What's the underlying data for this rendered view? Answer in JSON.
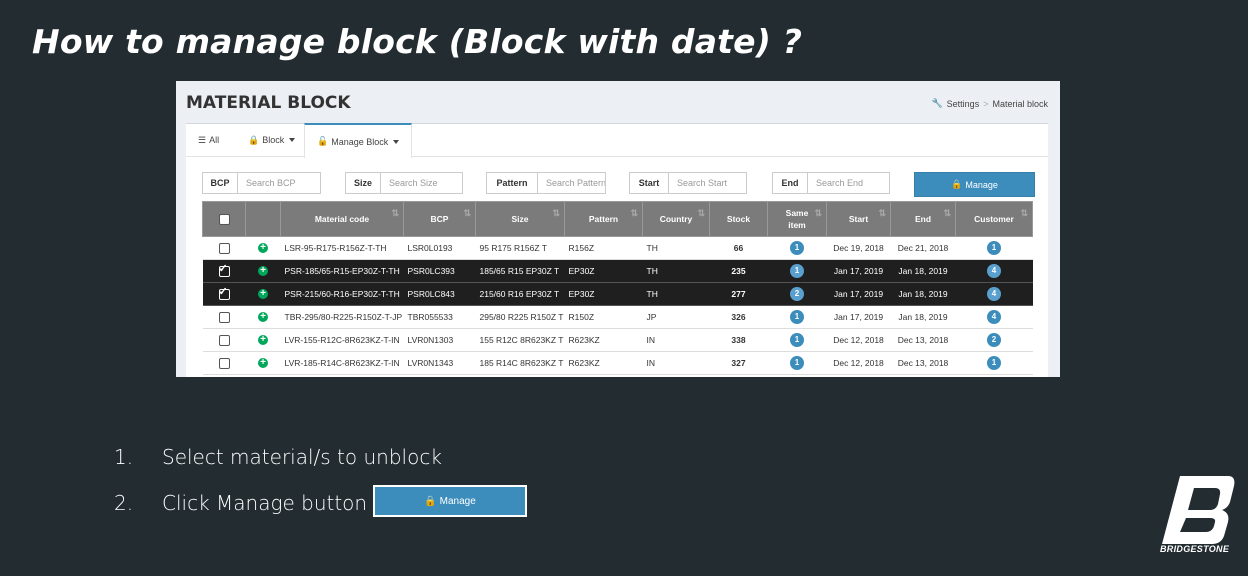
{
  "slide": {
    "title": "How to manage block (Block with date) ?"
  },
  "header": {
    "title": "MATERIAL BLOCK",
    "breadcrumb": [
      "Settings",
      "Material block"
    ]
  },
  "tabs": [
    {
      "label": "All",
      "icon": "list-icon"
    },
    {
      "label": "Block",
      "icon": "lock-icon"
    },
    {
      "label": "Manage Block",
      "icon": "unlock-icon"
    }
  ],
  "filters": [
    {
      "label": "BCP",
      "placeholder": "Search BCP"
    },
    {
      "label": "Size",
      "placeholder": "Search Size"
    },
    {
      "label": "Pattern",
      "placeholder": "Search Pattern"
    },
    {
      "label": "Start",
      "placeholder": "Search Start"
    },
    {
      "label": "End",
      "placeholder": "Search End"
    }
  ],
  "manage_button": {
    "label": "Manage"
  },
  "table": {
    "columns": [
      "",
      "",
      "Material code",
      "BCP",
      "Size",
      "Pattern",
      "Country",
      "Stock",
      "Same item",
      "Start",
      "End",
      "Customer"
    ],
    "rows": [
      {
        "checked": false,
        "material": "LSR-95-R175-R156Z-T-TH",
        "bcp": "LSR0L0193",
        "size": "95 R175 R156Z T",
        "pattern": "R156Z",
        "country": "TH",
        "stock": "66",
        "same": "1",
        "start": "Dec 19, 2018",
        "end": "Dec 21, 2018",
        "customer": "1"
      },
      {
        "checked": true,
        "material": "PSR-185/65-R15-EP30Z-T-TH",
        "bcp": "PSR0LC393",
        "size": "185/65 R15 EP30Z T",
        "pattern": "EP30Z",
        "country": "TH",
        "stock": "235",
        "same": "1",
        "start": "Jan 17, 2019",
        "end": "Jan 18, 2019",
        "customer": "4"
      },
      {
        "checked": true,
        "material": "PSR-215/60-R16-EP30Z-T-TH",
        "bcp": "PSR0LC843",
        "size": "215/60 R16 EP30Z T",
        "pattern": "EP30Z",
        "country": "TH",
        "stock": "277",
        "same": "2",
        "start": "Jan 17, 2019",
        "end": "Jan 18, 2019",
        "customer": "4"
      },
      {
        "checked": false,
        "material": "TBR-295/80-R225-R150Z-T-JP",
        "bcp": "TBR055533",
        "size": "295/80 R225 R150Z T",
        "pattern": "R150Z",
        "country": "JP",
        "stock": "326",
        "same": "1",
        "start": "Jan 17, 2019",
        "end": "Jan 18, 2019",
        "customer": "4"
      },
      {
        "checked": false,
        "material": "LVR-155-R12C-8R623KZ-T-IN",
        "bcp": "LVR0N1303",
        "size": "155 R12C 8R623KZ T",
        "pattern": "R623KZ",
        "country": "IN",
        "stock": "338",
        "same": "1",
        "start": "Dec 12, 2018",
        "end": "Dec 13, 2018",
        "customer": "2"
      },
      {
        "checked": false,
        "material": "LVR-185-R14C-8R623KZ-T-IN",
        "bcp": "LVR0N1343",
        "size": "185 R14C 8R623KZ T",
        "pattern": "R623KZ",
        "country": "IN",
        "stock": "327",
        "same": "1",
        "start": "Dec 12, 2018",
        "end": "Dec 13, 2018",
        "customer": "1"
      }
    ]
  },
  "steps": [
    {
      "num": "1.",
      "text": "Select material/s to unblock"
    },
    {
      "num": "2.",
      "text": "Click Manage button"
    }
  ],
  "step_button": {
    "label": "Manage"
  },
  "logo": {
    "text": "BRIDGESTONE"
  },
  "colors": {
    "background": "#232c31",
    "accent": "#3c8dbc",
    "success": "#00a65a"
  }
}
